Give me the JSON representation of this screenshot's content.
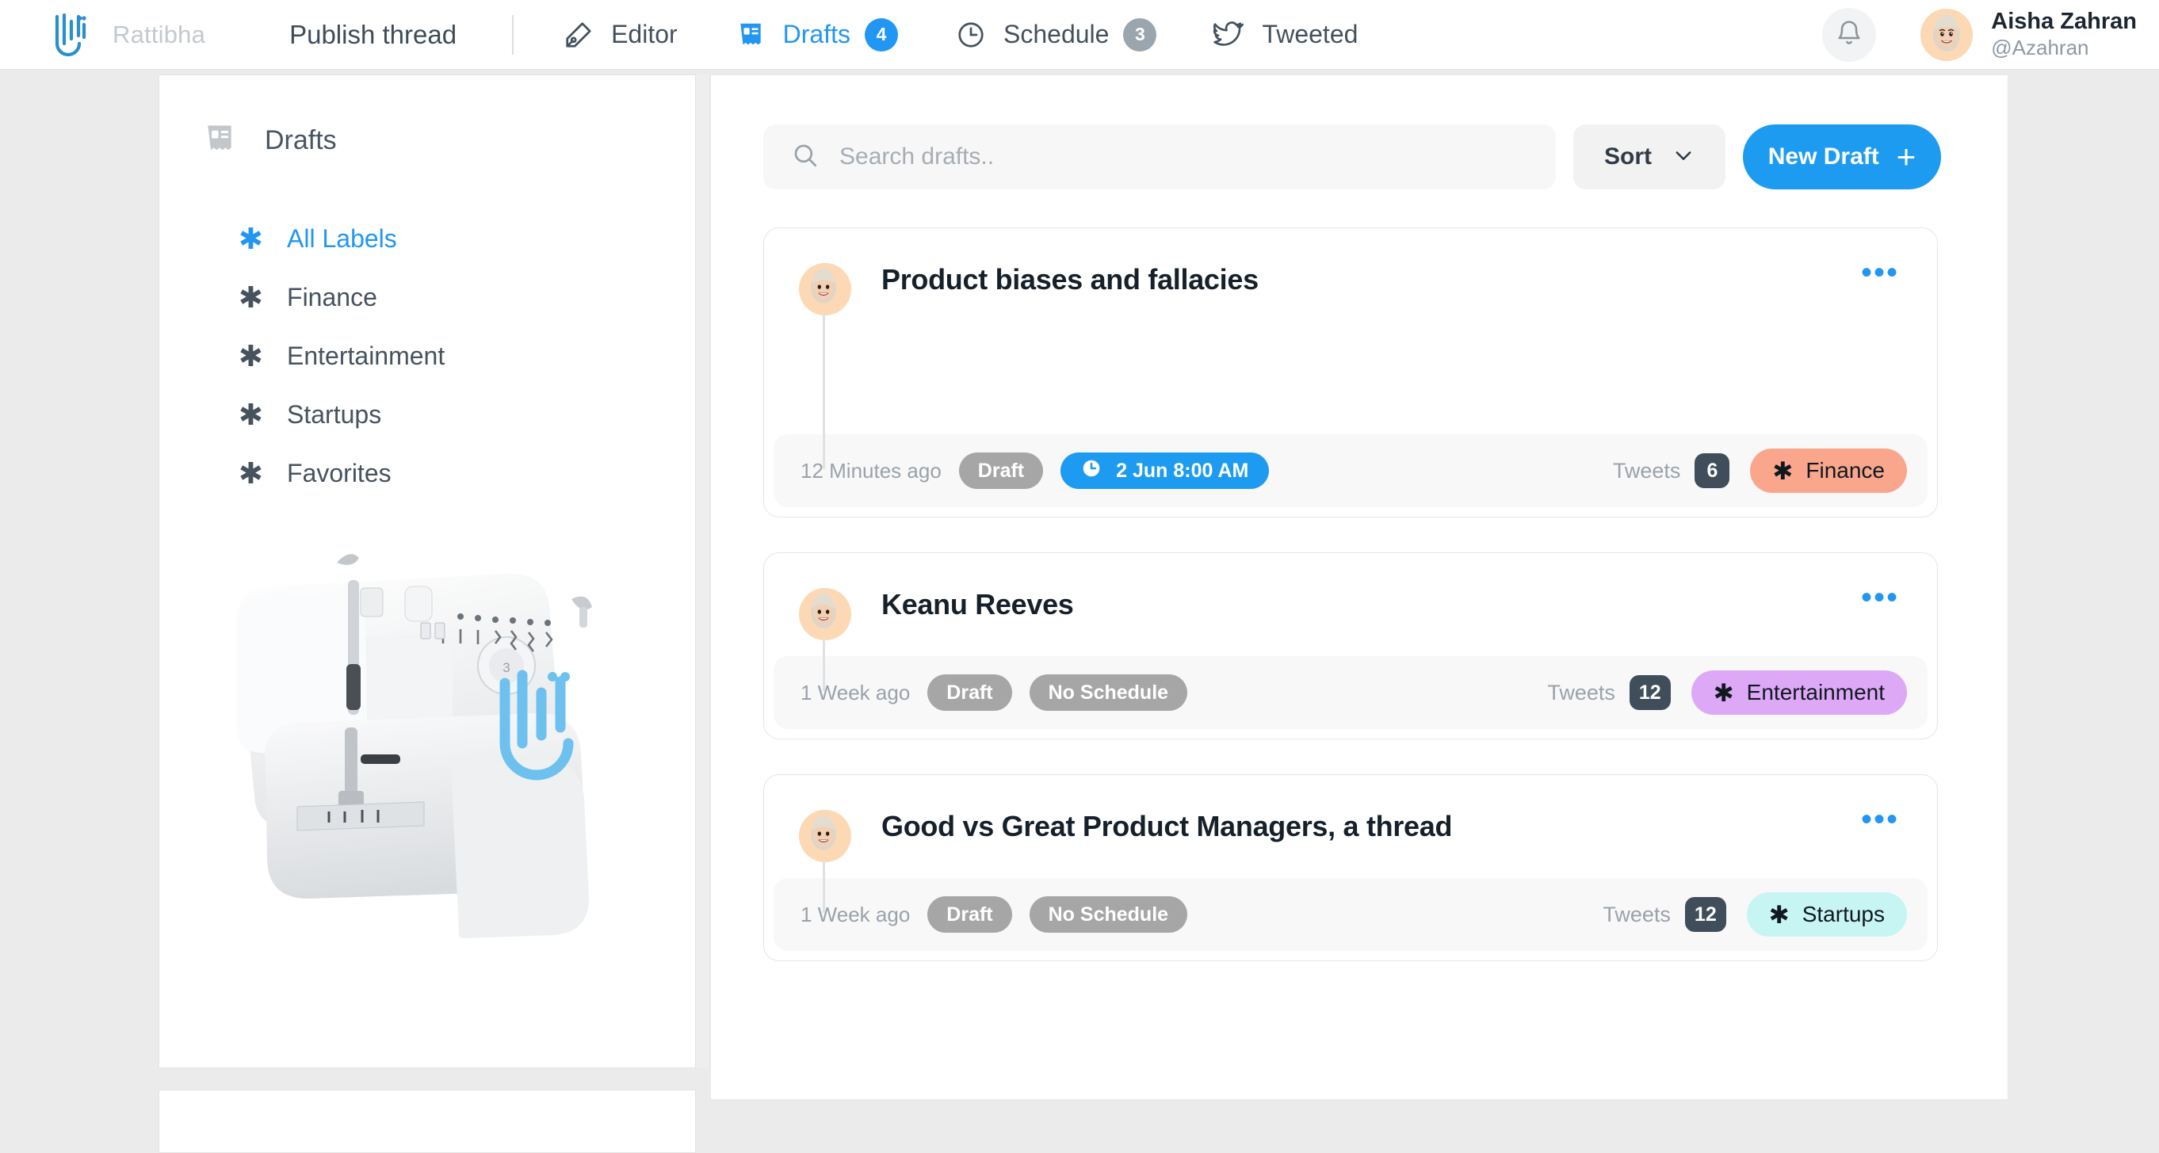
{
  "header": {
    "brand_name": "Rattibha",
    "brand_logo_icon": "rattibha-logo-icon",
    "page_title": "Publish thread",
    "nav": [
      {
        "label": "Editor",
        "icon": "pen-nib-icon",
        "badge": null,
        "active": false
      },
      {
        "label": "Drafts",
        "icon": "receipt-icon",
        "badge": "4",
        "active": true
      },
      {
        "label": "Schedule",
        "icon": "clock-icon",
        "badge": "3",
        "active": false
      },
      {
        "label": "Tweeted",
        "icon": "twitter-bird-icon",
        "badge": null,
        "active": false
      }
    ],
    "notifications_icon": "bell-icon",
    "user": {
      "name": "Aisha Zahran",
      "handle": "@Azahran",
      "avatar_icon": "user-avatar"
    }
  },
  "sidebar": {
    "title": "Drafts",
    "title_icon": "receipt-icon",
    "items": [
      {
        "label": "All Labels",
        "icon": "asterisk-icon",
        "active": true
      },
      {
        "label": "Finance",
        "icon": "asterisk-icon",
        "active": false
      },
      {
        "label": "Entertainment",
        "icon": "asterisk-icon",
        "active": false
      },
      {
        "label": "Startups",
        "icon": "asterisk-icon",
        "active": false
      },
      {
        "label": "Favorites",
        "icon": "asterisk-icon",
        "active": false
      }
    ],
    "promo_image": "sewing-machine-photo"
  },
  "toolbar": {
    "search_placeholder": "Search drafts..",
    "search_value": "",
    "search_icon": "search-icon",
    "sort_label": "Sort",
    "sort_icon": "chevron-down-icon",
    "new_draft_label": "New Draft",
    "new_draft_icon": "plus-icon"
  },
  "colors": {
    "accent_blue": "#1d9bf0",
    "nav_active": "#2196f3",
    "finance_label": "#f9a68c",
    "entertainment_label": "#dda9f7",
    "startups_label": "#c7f5f3",
    "draft_pill": "#a6a6a6",
    "count_badge": "#3f4e5a",
    "page_bg": "#ebebeb"
  },
  "drafts": [
    {
      "title": "Product biases and fallacies",
      "time_ago": "12 Minutes ago",
      "status": "Draft",
      "schedule": "2 Jun  8:00 AM",
      "schedule_icon": "clock-icon",
      "scheduled": true,
      "tweets_label": "Tweets",
      "tweets_count": "6",
      "label": "Finance",
      "label_color": "#f9a68c",
      "menu_icon": "more-options-icon"
    },
    {
      "title": "Keanu Reeves",
      "time_ago": "1 Week ago",
      "status": "Draft",
      "schedule": "No Schedule",
      "scheduled": false,
      "tweets_label": "Tweets",
      "tweets_count": "12",
      "label": "Entertainment",
      "label_color": "#dda9f7",
      "menu_icon": "more-options-icon"
    },
    {
      "title": "Good vs Great Product Managers, a thread",
      "time_ago": "1 Week ago",
      "status": "Draft",
      "schedule": "No Schedule",
      "scheduled": false,
      "tweets_label": "Tweets",
      "tweets_count": "12",
      "label": "Startups",
      "label_color": "#c7f5f3",
      "menu_icon": "more-options-icon"
    }
  ]
}
